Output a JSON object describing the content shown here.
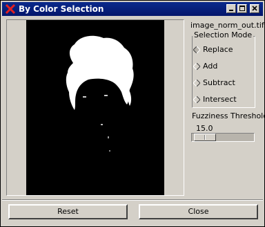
{
  "window": {
    "title": "By Color Selection",
    "title_color": "#0a2a8c",
    "controls": [
      "minimize-icon",
      "maximize-icon",
      "close-icon"
    ]
  },
  "image": {
    "filename": "image_norm_out.tif"
  },
  "selection_mode": {
    "legend": "Selection Mode",
    "options": [
      {
        "label": "Replace",
        "selected": true
      },
      {
        "label": "Add",
        "selected": false
      },
      {
        "label": "Subtract",
        "selected": false
      },
      {
        "label": "Intersect",
        "selected": false
      }
    ]
  },
  "fuzziness": {
    "label": "Fuzziness Threshold",
    "value": "15.0",
    "fraction": 0.06
  },
  "buttons": {
    "reset": "Reset",
    "close": "Close"
  }
}
